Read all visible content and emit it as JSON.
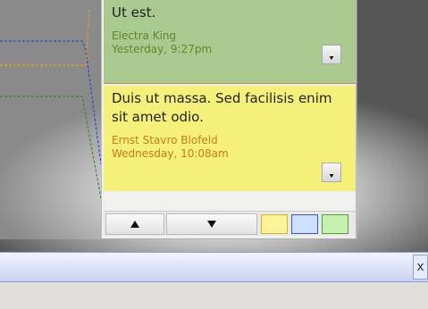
{
  "notes": [
    {
      "text": "Ut est.",
      "author": "Electra King",
      "time": "Yesterday, 9:27pm",
      "color": "#a9c98e"
    },
    {
      "text": "Duis ut massa. Sed facilisis enim sit amet odio.",
      "author": "Ernst Stavro Blofeld",
      "time": "Wednesday, 10:08am",
      "color": "#f5f07a"
    }
  ],
  "toolbar": {
    "up_icon": "triangle-up-icon",
    "down_icon": "triangle-down-icon",
    "swatches": [
      {
        "name": "yellow",
        "color": "#fbf39a"
      },
      {
        "name": "blue",
        "color": "#cfe0ff"
      },
      {
        "name": "green",
        "color": "#c6f0b0"
      }
    ]
  },
  "bottom_bar": {
    "close_label": "x"
  }
}
